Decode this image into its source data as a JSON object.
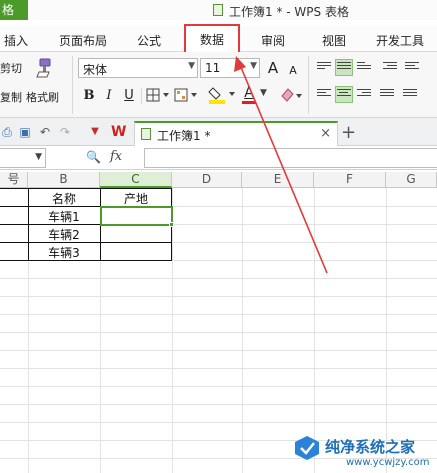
{
  "app": {
    "badge": "格",
    "window_title": "工作簿1 * - WPS 表格"
  },
  "ribbon_tabs": [
    "插入",
    "页面布局",
    "公式",
    "数据",
    "审阅",
    "视图",
    "开发工具"
  ],
  "ribbon": {
    "cut_label": "剪切",
    "copy_label": "复制",
    "format_painter_label": "格式刷",
    "font_name": "宋体",
    "font_size": "11",
    "bold": "B",
    "italic": "I",
    "underline": "U",
    "grow_font": "A",
    "shrink_font": "A",
    "font_color_letter": "A",
    "font_color": "#e02020",
    "fill_color": "#ffe400"
  },
  "doc_tab": {
    "name": "工作簿1 *",
    "close": "×",
    "new": "+"
  },
  "formula_bar": {
    "name_box": "",
    "fx": "fx",
    "content": ""
  },
  "sheet": {
    "columns": [
      "号",
      "B",
      "C",
      "D",
      "E",
      "F",
      "G"
    ],
    "active_column": "C",
    "header_row": [
      "名称",
      "产地"
    ],
    "rows": [
      [
        "车辆1",
        ""
      ],
      [
        "车辆2",
        ""
      ],
      [
        "车辆3",
        ""
      ]
    ],
    "selected_cell": "C2"
  },
  "colors": {
    "accent_green": "#4c9a2a",
    "annotation_red": "#e23a3a"
  },
  "watermark": {
    "title": "纯净系统之家",
    "url": "www.ycwjzy.com"
  }
}
